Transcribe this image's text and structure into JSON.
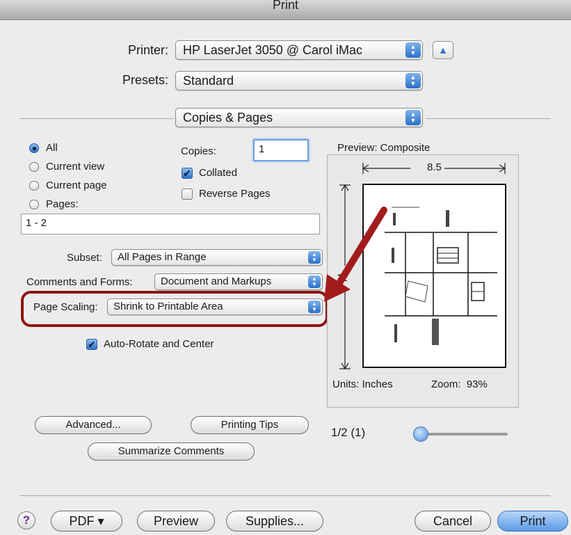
{
  "dialog": {
    "title": "Print"
  },
  "printer": {
    "label": "Printer:",
    "value": "HP LaserJet 3050 @ Carol iMac",
    "disclosure_symbol": "▲"
  },
  "presets": {
    "label": "Presets:",
    "value": "Standard"
  },
  "panel": {
    "value": "Copies & Pages"
  },
  "pages": {
    "options": [
      {
        "label": "All",
        "selected": true
      },
      {
        "label": "Current view",
        "selected": false
      },
      {
        "label": "Current page",
        "selected": false
      },
      {
        "label": "Pages:",
        "selected": false
      }
    ],
    "range_value": "1 - 2"
  },
  "copies": {
    "label": "Copies:",
    "value": "1",
    "collated": {
      "label": "Collated",
      "checked": true
    },
    "reverse": {
      "label": "Reverse Pages",
      "checked": false
    }
  },
  "subset": {
    "label": "Subset:",
    "value": "All Pages in Range"
  },
  "comments_forms": {
    "label": "Comments and Forms:",
    "value": "Document and Markups"
  },
  "page_scaling": {
    "label": "Page Scaling:",
    "value": "Shrink to Printable Area"
  },
  "auto_rotate": {
    "label": "Auto-Rotate and Center",
    "checked": true
  },
  "preview": {
    "title": "Preview: Composite",
    "width_label": "8.5",
    "height_label": "11",
    "units": "Units: Inches",
    "zoom": "Zoom:  93%",
    "page_indicator": "1/2 (1)",
    "slider_level": 0
  },
  "buttons": {
    "advanced": "Advanced...",
    "printing_tips": "Printing Tips",
    "summarize_comments": "Summarize Comments",
    "help": "?",
    "pdf": "PDF ▾",
    "preview": "Preview",
    "supplies": "Supplies...",
    "cancel": "Cancel",
    "print": "Print"
  },
  "colors": {
    "accent": "#2a6fc9",
    "annotation": "#8b1616"
  },
  "icons": {
    "popup": "updown-arrows-icon",
    "annotation_arrow": "red-arrow-icon"
  }
}
